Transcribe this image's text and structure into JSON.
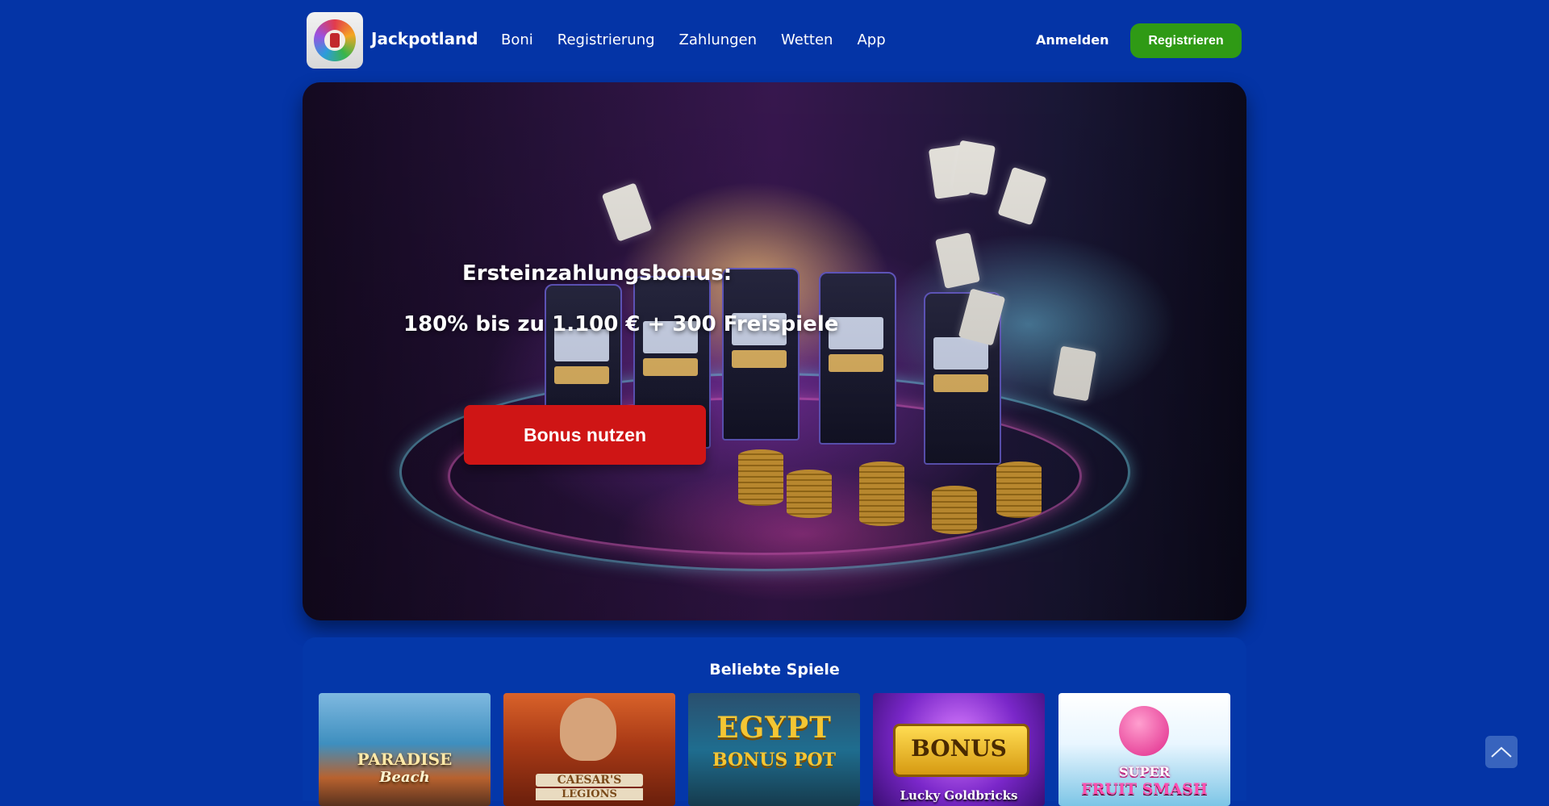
{
  "header": {
    "brand": "Jackpotland",
    "nav": [
      "Boni",
      "Registrierung",
      "Zahlungen",
      "Wetten",
      "App"
    ],
    "login_label": "Anmelden",
    "register_label": "Registrieren"
  },
  "hero": {
    "title": "Ersteinzahlungsbonus:",
    "offer": "180% bis zu 1.100 € + 300 Freispiele",
    "cta_label": "Bonus nutzen"
  },
  "games": {
    "title": "Beliebte Spiele",
    "tiles": [
      {
        "label_1": "PARADISE",
        "label_2": "Beach"
      },
      {
        "label_1": "CAESAR'S",
        "label_2": "LEGIONS"
      },
      {
        "label_1": "EGYPT",
        "label_2": "BONUS POT"
      },
      {
        "label_1": "BONUS",
        "label_2": "Lucky Goldbricks"
      },
      {
        "label_1": "SUPER",
        "label_2": "FRUIT SMASH"
      }
    ]
  },
  "colors": {
    "page_bg": "#0434a6",
    "register_button": "#2f9a15",
    "cta_button": "#cf1515"
  },
  "icons": {
    "logo": "wreath-logo-icon",
    "scroll_top": "chevron-up-icon"
  }
}
